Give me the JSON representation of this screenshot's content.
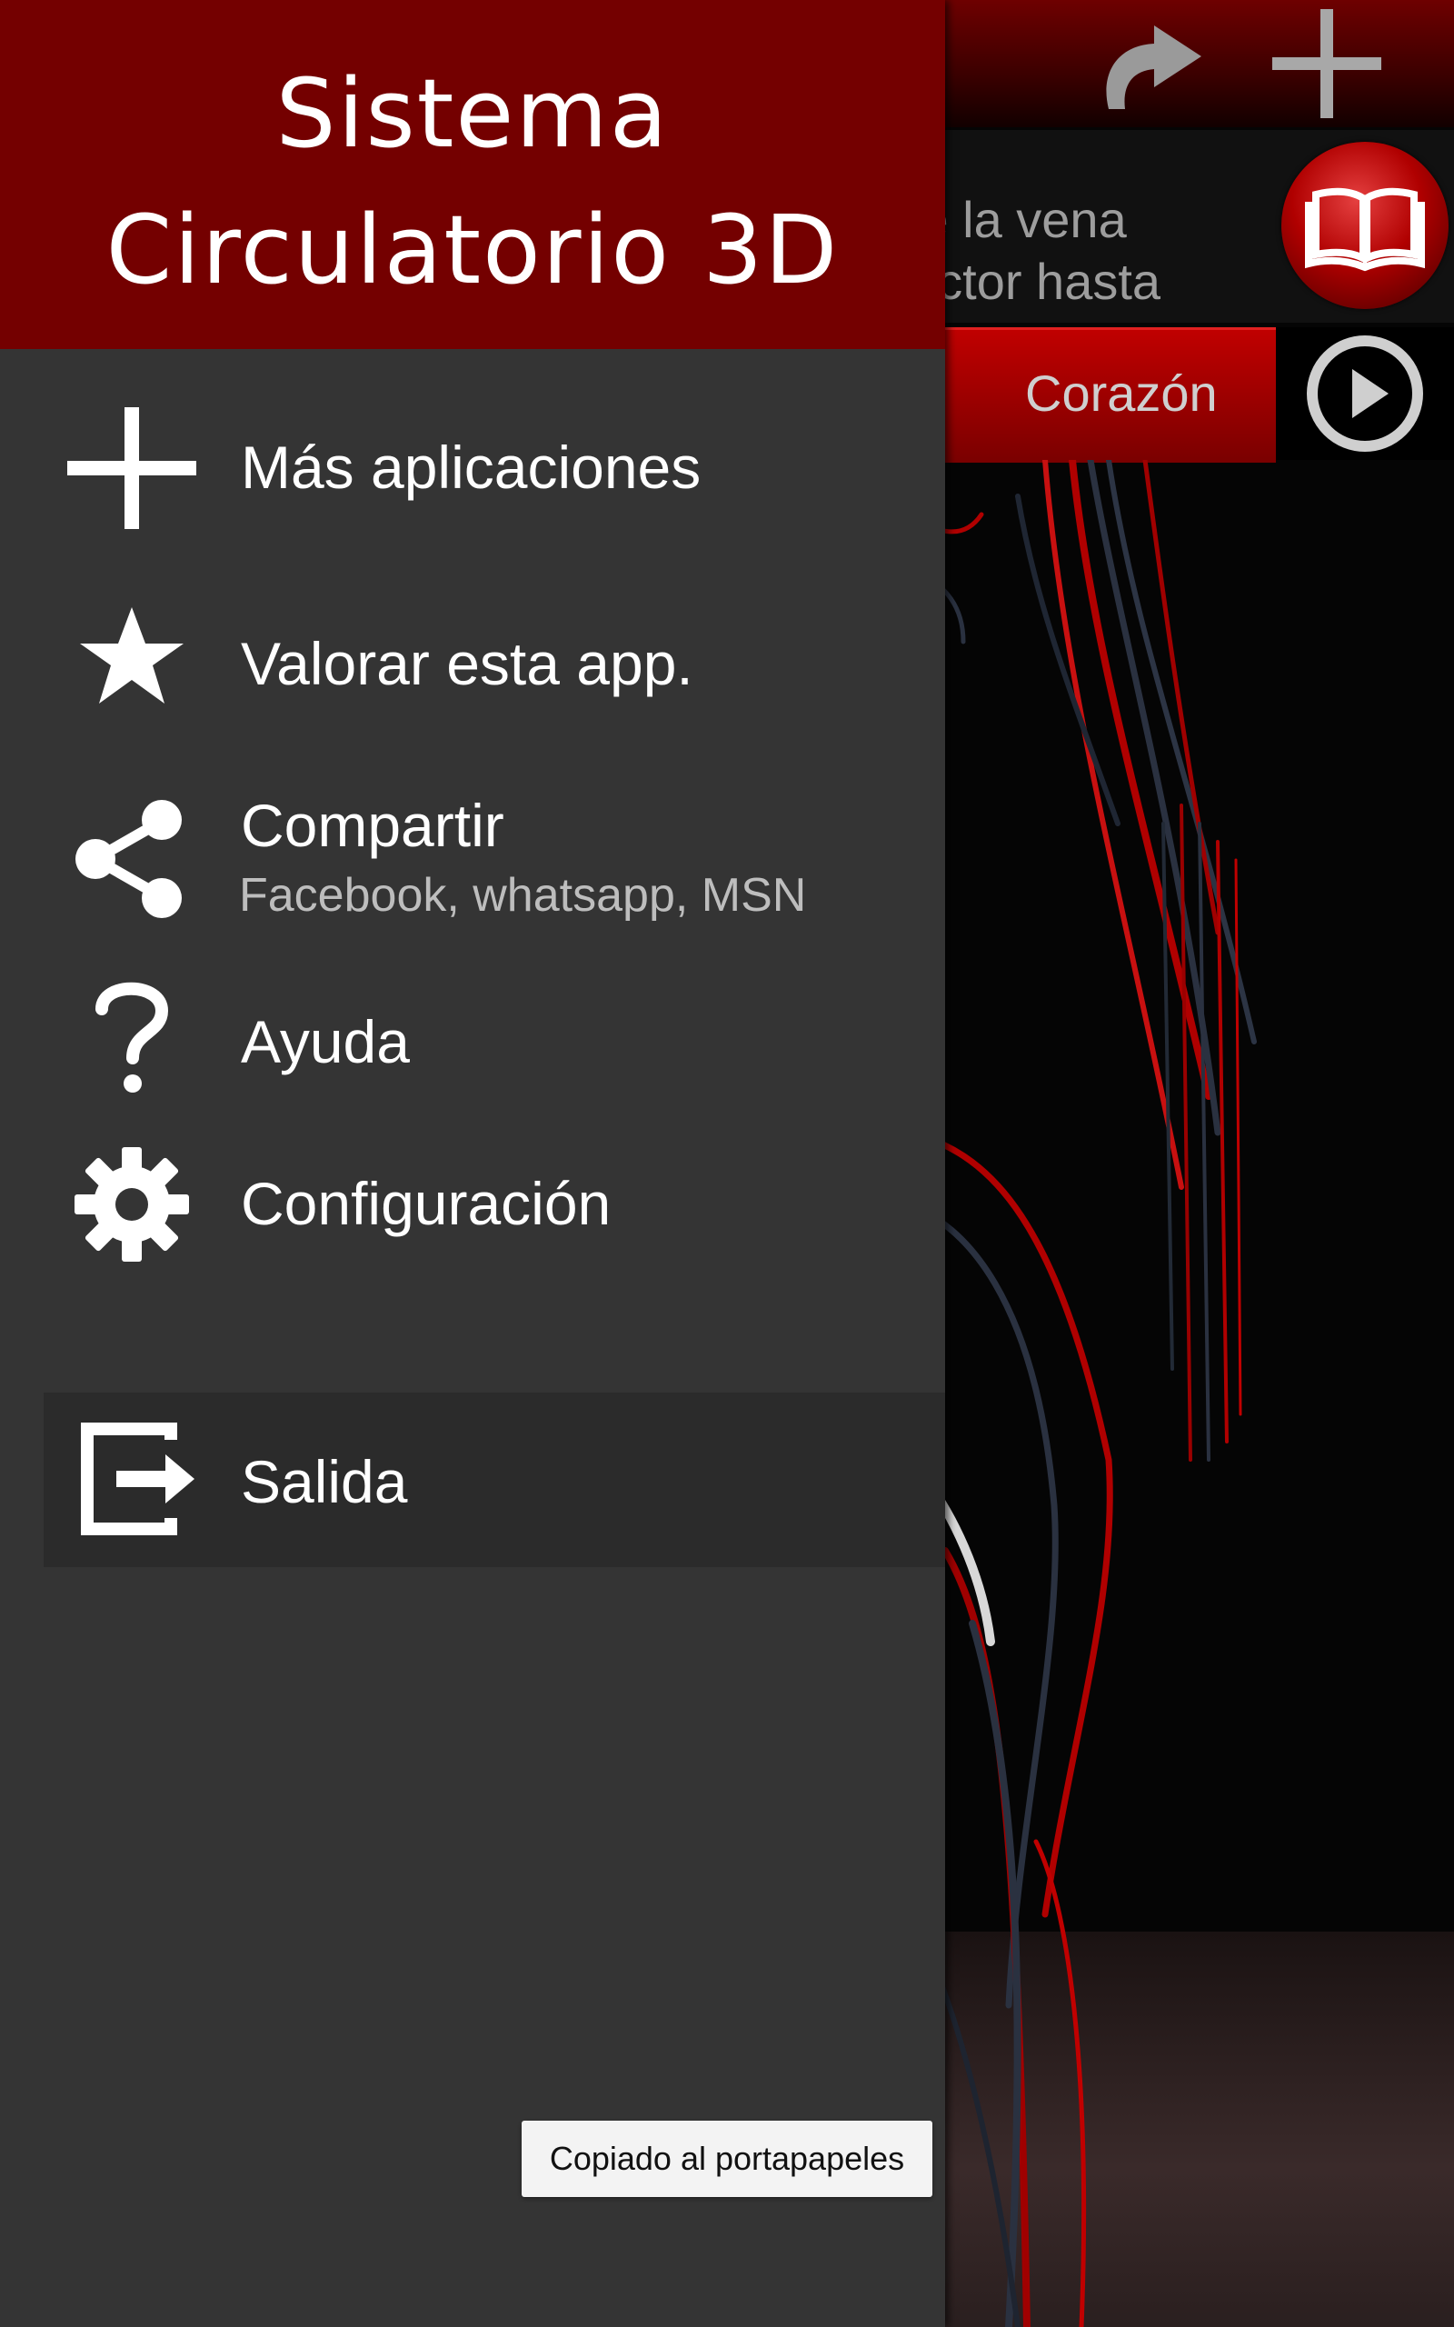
{
  "background_app": {
    "description_text": "le la vena\nuctor hasta",
    "heart_label": "Corazón",
    "icons": [
      "redo-icon",
      "plus-icon",
      "book-icon",
      "play-icon"
    ]
  },
  "drawer": {
    "title": "Sistema\nCirculatorio 3D",
    "items": [
      {
        "label": "Más aplicaciones",
        "icon": "plus-icon"
      },
      {
        "label": "Valorar esta app.",
        "icon": "star-icon"
      },
      {
        "label": "Compartir",
        "sublabel": "Facebook, whatsapp, MSN",
        "icon": "share-icon"
      },
      {
        "label": "Ayuda",
        "icon": "question-icon"
      },
      {
        "label": "Configuración",
        "icon": "gear-icon"
      },
      {
        "label": "Salida",
        "icon": "exit-icon"
      }
    ]
  },
  "toast": {
    "message": "Copiado al portapapeles"
  },
  "colors": {
    "header_red": "#740000",
    "drawer_bg": "#343434",
    "accent_red": "#c00000"
  }
}
